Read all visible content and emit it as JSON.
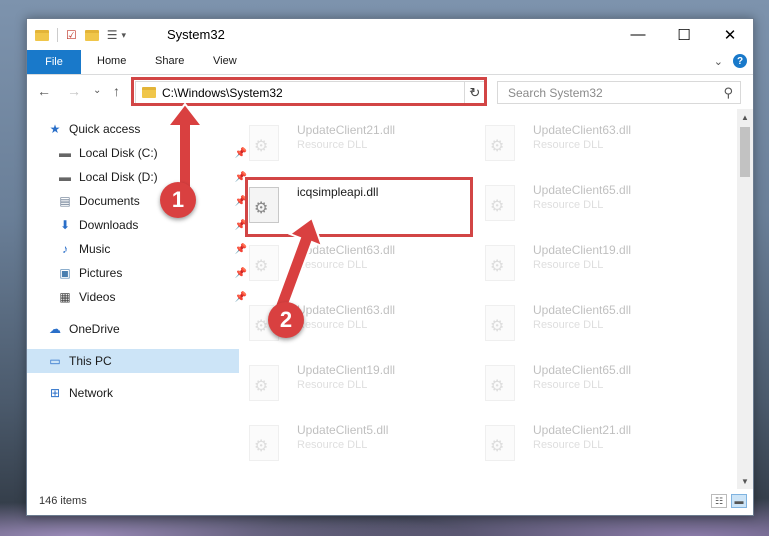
{
  "window": {
    "title": "System32"
  },
  "window_controls": {
    "minimize": "—",
    "maximize": "☐",
    "close": "✕"
  },
  "ribbon": {
    "file": "File",
    "home": "Home",
    "share": "Share",
    "view": "View",
    "collapse": "⌄",
    "help": "?"
  },
  "nav": {
    "back": "←",
    "forward": "→",
    "recent": "⌄",
    "up": "↑",
    "address": "C:\\Windows\\System32",
    "address_dropdown": "⌄",
    "refresh": "↻",
    "search_placeholder": "Search System32",
    "search_icon": "⚲"
  },
  "sidebar": {
    "items": [
      {
        "label": "Quick access",
        "icon": "star-icon"
      },
      {
        "label": "Local Disk (C:)",
        "icon": "drive-icon"
      },
      {
        "label": "Local Disk (D:)",
        "icon": "drive-icon"
      },
      {
        "label": "Documents",
        "icon": "documents-icon"
      },
      {
        "label": "Downloads",
        "icon": "downloads-icon"
      },
      {
        "label": "Music",
        "icon": "music-icon"
      },
      {
        "label": "Pictures",
        "icon": "pictures-icon"
      },
      {
        "label": "Videos",
        "icon": "videos-icon"
      },
      {
        "label": "OneDrive",
        "icon": "cloud-icon"
      },
      {
        "label": "This PC",
        "icon": "pc-icon"
      },
      {
        "label": "Network",
        "icon": "network-icon"
      }
    ]
  },
  "files": {
    "col1": [
      {
        "name": "UpdateClient21.dll",
        "type": "Resource DLL"
      },
      {
        "name": "icqsimpleapi.dll",
        "type": ""
      },
      {
        "name": "UpdateClient63.dll",
        "type": "Resource DLL"
      },
      {
        "name": "UpdateClient63.dll",
        "type": "Resource DLL"
      },
      {
        "name": "UpdateClient19.dll",
        "type": "Resource DLL"
      },
      {
        "name": "UpdateClient5.dll",
        "type": "Resource DLL"
      }
    ],
    "col2": [
      {
        "name": "UpdateClient63.dll",
        "type": "Resource DLL"
      },
      {
        "name": "UpdateClient65.dll",
        "type": "Resource DLL"
      },
      {
        "name": "UpdateClient19.dll",
        "type": "Resource DLL"
      },
      {
        "name": "UpdateClient65.dll",
        "type": "Resource DLL"
      },
      {
        "name": "UpdateClient65.dll",
        "type": "Resource DLL"
      },
      {
        "name": "UpdateClient21.dll",
        "type": "Resource DLL"
      }
    ]
  },
  "status": {
    "items": "146 items"
  },
  "annotations": {
    "step1": "1",
    "step2": "2"
  },
  "colors": {
    "accent": "#1979ca",
    "highlight": "#d24545",
    "selection": "#cce4f7"
  }
}
